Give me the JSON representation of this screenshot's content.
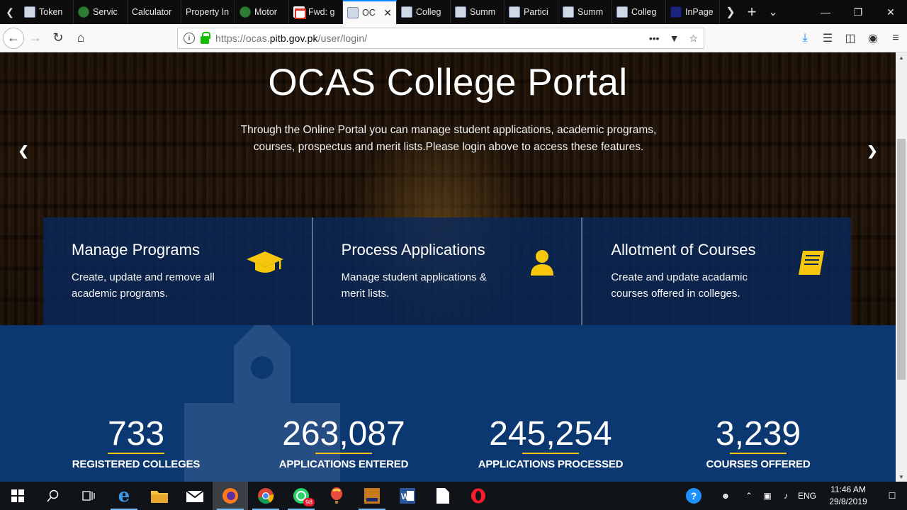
{
  "browser": {
    "tabs": [
      {
        "label": "Token",
        "icon": "pitb-icon",
        "active": false
      },
      {
        "label": "Servic",
        "icon": "globe-green-icon",
        "active": false
      },
      {
        "label": "Calculator",
        "icon": "none",
        "active": false
      },
      {
        "label": "Property In",
        "icon": "none",
        "active": false
      },
      {
        "label": "Motor",
        "icon": "globe-green-icon",
        "active": false
      },
      {
        "label": "Fwd: g",
        "icon": "gmail-icon",
        "active": false
      },
      {
        "label": "OC",
        "icon": "pitb-icon",
        "active": true
      },
      {
        "label": "Colleg",
        "icon": "pitb-icon",
        "active": false
      },
      {
        "label": "Summ",
        "icon": "pitb-icon",
        "active": false
      },
      {
        "label": "Partici",
        "icon": "pitb-icon",
        "active": false
      },
      {
        "label": "Summ",
        "icon": "pitb-icon",
        "active": false
      },
      {
        "label": "Colleg",
        "icon": "pitb-icon",
        "active": false
      },
      {
        "label": "InPage",
        "icon": "inpage-icon",
        "active": false
      }
    ],
    "url_prefix": "https://ocas.",
    "url_domain": "pitb.gov.pk",
    "url_path": "/user/login/"
  },
  "hero": {
    "title": "OCAS College Portal",
    "description": "Through the Online Portal you can manage student applications, academic programs, courses, prospectus and merit lists.Please login above to access these features."
  },
  "features": [
    {
      "title": "Manage Programs",
      "text": "Create, update and remove all academic programs.",
      "icon": "graduation-cap-icon"
    },
    {
      "title": "Process Applications",
      "text": "Manage student applications & merit lists.",
      "icon": "user-icon"
    },
    {
      "title": "Allotment of Courses",
      "text": "Create and update acadamic courses offered in colleges.",
      "icon": "book-icon"
    }
  ],
  "stats": [
    {
      "value": "733",
      "label": "REGISTERED COLLEGES"
    },
    {
      "value": "263,087",
      "label": "APPLICATIONS ENTERED"
    },
    {
      "value": "245,254",
      "label": "APPLICATIONS PROCESSED"
    },
    {
      "value": "3,239",
      "label": "COURSES OFFERED"
    }
  ],
  "taskbar": {
    "whatsapp_badge": "98",
    "language": "ENG",
    "time": "11:46 AM",
    "date": "29/8/2019"
  },
  "colors": {
    "accent": "#f5c60b",
    "feature_panel": "#08285a",
    "stats_bg": "#0c3872"
  }
}
